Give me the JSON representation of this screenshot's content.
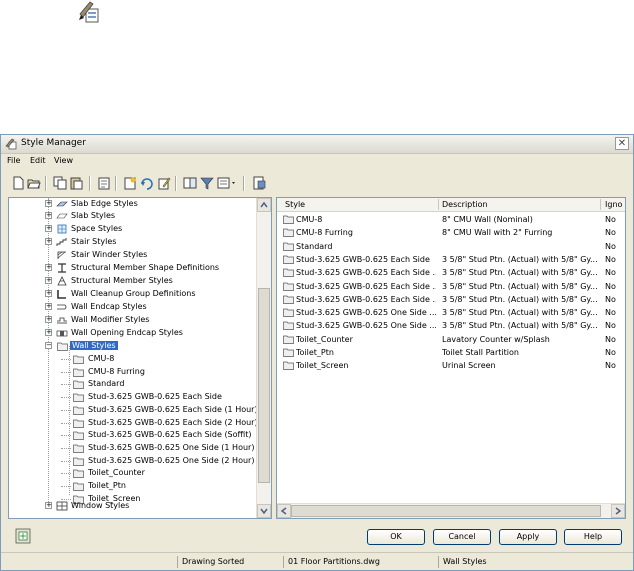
{
  "window": {
    "title": "Style Manager",
    "close_label": "✕"
  },
  "menu": [
    "File",
    "Edit",
    "View"
  ],
  "toolbar_icons": [
    "new-icon",
    "open-icon",
    "copy-icon",
    "paste-icon",
    "purge-icon",
    "new-style-icon",
    "set-from-icon",
    "edit-icon",
    "toggle-view-icon",
    "filter-icon",
    "view-options-icon",
    "display-icon"
  ],
  "tree": {
    "categories": [
      {
        "label": "Slab Edge Styles",
        "icon": "slab-edge-icon"
      },
      {
        "label": "Slab Styles",
        "icon": "slab-icon"
      },
      {
        "label": "Space Styles",
        "icon": "space-icon"
      },
      {
        "label": "Stair Styles",
        "icon": "stair-icon"
      },
      {
        "label": "Stair Winder Styles",
        "icon": "stair-winder-icon"
      },
      {
        "label": "Structural Member Shape Definitions",
        "icon": "structural-shape-icon"
      },
      {
        "label": "Structural Member Styles",
        "icon": "structural-member-icon"
      },
      {
        "label": "Wall Cleanup Group Definitions",
        "icon": "wall-cleanup-icon"
      },
      {
        "label": "Wall Endcap Styles",
        "icon": "wall-endcap-icon"
      },
      {
        "label": "Wall Modifier Styles",
        "icon": "wall-modifier-icon"
      },
      {
        "label": "Wall Opening Endcap Styles",
        "icon": "wall-opening-endcap-icon"
      }
    ],
    "selected": "Wall Styles",
    "wall_styles": [
      "CMU-8",
      "CMU-8 Furring",
      "Standard",
      "Stud-3.625 GWB-0.625 Each Side",
      "Stud-3.625 GWB-0.625 Each Side (1 Hour)",
      "Stud-3.625 GWB-0.625 Each Side (2 Hour)",
      "Stud-3.625 GWB-0.625 Each Side (Soffit)",
      "Stud-3.625 GWB-0.625 One Side (1 Hour)",
      "Stud-3.625 GWB-0.625 One Side (2 Hour)",
      "Toilet_Counter",
      "Toilet_Ptn",
      "Toilet_Screen"
    ],
    "last": "Window Styles"
  },
  "list": {
    "columns": [
      "Style",
      "Description",
      "Igno"
    ],
    "rows": [
      [
        "CMU-8",
        "8\" CMU Wall (Nominal)",
        "No"
      ],
      [
        "CMU-8 Furring",
        "8\" CMU Wall with 2\" Furring",
        "No"
      ],
      [
        "Standard",
        "",
        "No"
      ],
      [
        "Stud-3.625 GWB-0.625 Each Side",
        "3 5/8\" Stud Ptn. (Actual) with 5/8\" Gy...",
        "No"
      ],
      [
        "Stud-3.625 GWB-0.625 Each Side ...",
        "3 5/8\" Stud Ptn. (Actual) with 5/8\" Gy...",
        "No"
      ],
      [
        "Stud-3.625 GWB-0.625 Each Side ...",
        "3 5/8\" Stud Ptn. (Actual) with 5/8\" Gy...",
        "No"
      ],
      [
        "Stud-3.625 GWB-0.625 Each Side ...",
        "3 5/8\" Stud Ptn. (Actual) with 5/8\" Gy...",
        "No"
      ],
      [
        "Stud-3.625 GWB-0.625 One Side ...",
        "3 5/8\" Stud Ptn. (Actual) with 5/8\" Gy...",
        "No"
      ],
      [
        "Stud-3.625 GWB-0.625 One Side ...",
        "3 5/8\" Stud Ptn. (Actual) with 5/8\" Gy...",
        "No"
      ],
      [
        "Toilet_Counter",
        "Lavatory Counter w/Splash",
        "No"
      ],
      [
        "Toilet_Ptn",
        "Toilet Stall Partition",
        "No"
      ],
      [
        "Toilet_Screen",
        "Urinal Screen",
        "No"
      ]
    ]
  },
  "buttons": {
    "ok": "OK",
    "cancel": "Cancel",
    "apply": "Apply",
    "help": "Help"
  },
  "status": {
    "sort": "Drawing Sorted",
    "drawing": "01 Floor Partitions.dwg",
    "type": "Wall Styles"
  },
  "colors": {
    "selection": "#316ac5",
    "folder": "#e8e8e8",
    "frame": "#7f9db9",
    "button_border": "#003c74"
  }
}
